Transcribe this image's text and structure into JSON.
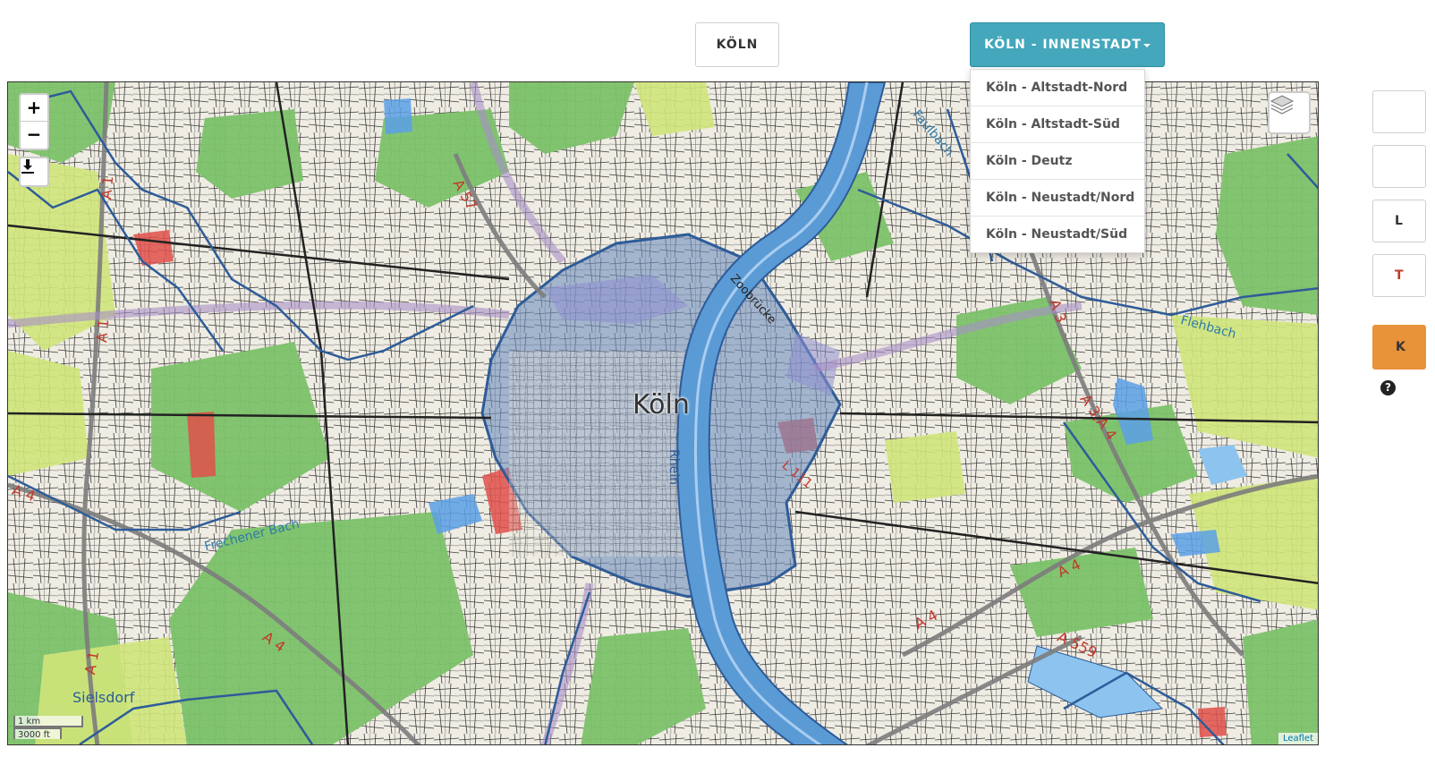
{
  "header": {
    "city_button": "KÖLN",
    "district_button": "KÖLN - INNENSTADT"
  },
  "dropdown": {
    "items": [
      "Köln - Altstadt-Nord",
      "Köln - Altstadt-Süd",
      "Köln - Deutz",
      "Köln - Neustadt/Nord",
      "Köln - Neustadt/Süd"
    ]
  },
  "map": {
    "zoom_in": "+",
    "zoom_out": "−",
    "scale_metric": "1 km",
    "scale_imperial": "3000 ft",
    "attribution": "Leaflet",
    "labels": {
      "city": "Köln",
      "river": "Rhein",
      "faulbach": "Faulbach",
      "flehbach": "Flehbach",
      "frechener_bach": "Frechener Bach",
      "sielsdorf": "Sielsdorf",
      "zoobruecke": "Zoobrücke",
      "a1_top": "A 1",
      "a1_mid": "A 1",
      "a1_bottom": "A 1",
      "a57": "A 57",
      "a3": "A 3",
      "a3a4": "A 3;A 4",
      "a4_left": "A 4",
      "a4_west": "A 4",
      "a4_right": "A 4",
      "a4_center": "A 4",
      "a559": "A 559",
      "l111": "L 111"
    },
    "colors": {
      "highlight": "#5b7fb0",
      "river": "#5b9bd5",
      "boundary": "#2e5c99"
    }
  },
  "side_panel": {
    "btn3": "L",
    "btn4": "T",
    "orange_btn": "K",
    "help": "?"
  }
}
